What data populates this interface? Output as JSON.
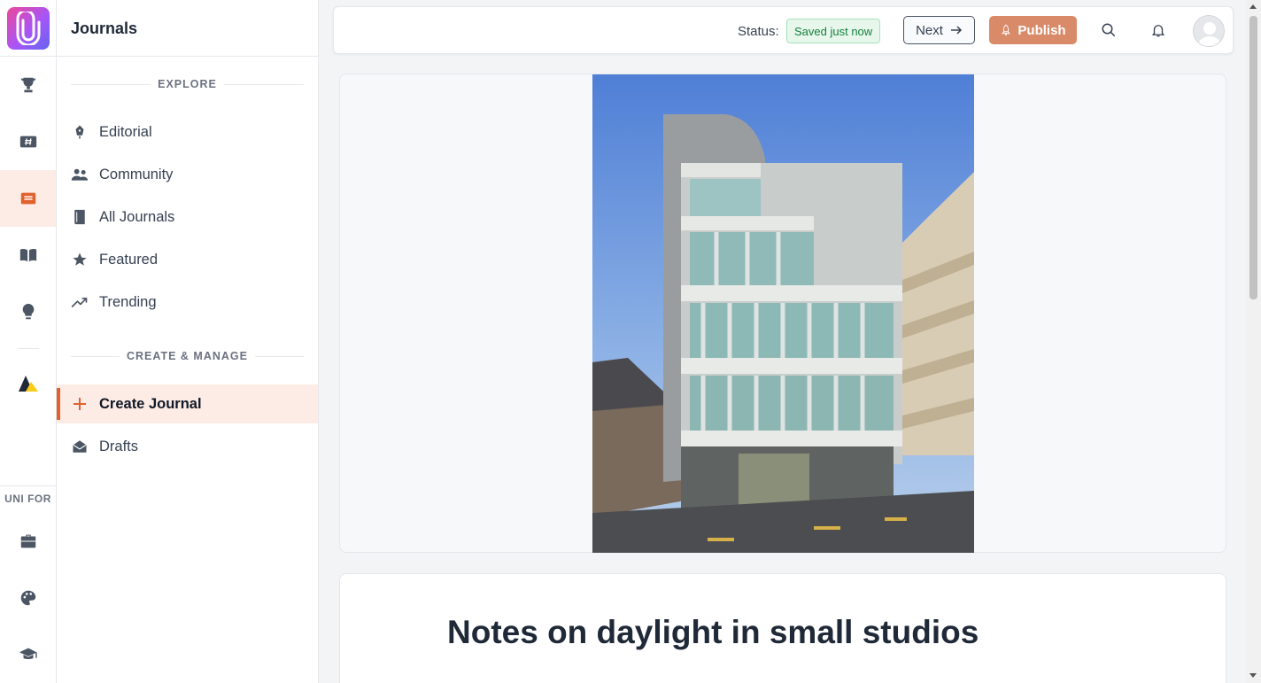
{
  "app": {
    "section_title": "Journals"
  },
  "rail": {
    "items": [
      {
        "icon": "trophy-icon"
      },
      {
        "icon": "hashtag-news-icon"
      },
      {
        "icon": "journal-icon",
        "active": true
      },
      {
        "icon": "open-book-icon"
      },
      {
        "icon": "lightbulb-icon"
      },
      {
        "icon": "brand-triangle-icon"
      }
    ],
    "group_label": "UNI FOR",
    "group_items": [
      {
        "icon": "briefcase-icon"
      },
      {
        "icon": "palette-icon"
      },
      {
        "icon": "graduation-cap-icon"
      }
    ]
  },
  "nav": {
    "explore_heading": "EXPLORE",
    "explore_items": [
      {
        "label": "Editorial",
        "icon": "pen-nib-icon"
      },
      {
        "label": "Community",
        "icon": "people-icon"
      },
      {
        "label": "All Journals",
        "icon": "book-icon"
      },
      {
        "label": "Featured",
        "icon": "star-icon"
      },
      {
        "label": "Trending",
        "icon": "trending-up-icon"
      }
    ],
    "manage_heading": "CREATE & MANAGE",
    "manage_items": [
      {
        "label": "Create Journal",
        "icon": "plus-icon",
        "active": true
      },
      {
        "label": "Drafts",
        "icon": "envelope-open-icon"
      }
    ]
  },
  "topbar": {
    "status_label": "Status:",
    "status_value": "Saved just now",
    "next_label": "Next",
    "publish_label": "Publish"
  },
  "editor": {
    "title": "Notes on daylight in small studios"
  },
  "colors": {
    "accent": "#e0622e",
    "publish": "#d98a68",
    "status_bg": "#e7f7ec",
    "status_text": "#15803d"
  }
}
